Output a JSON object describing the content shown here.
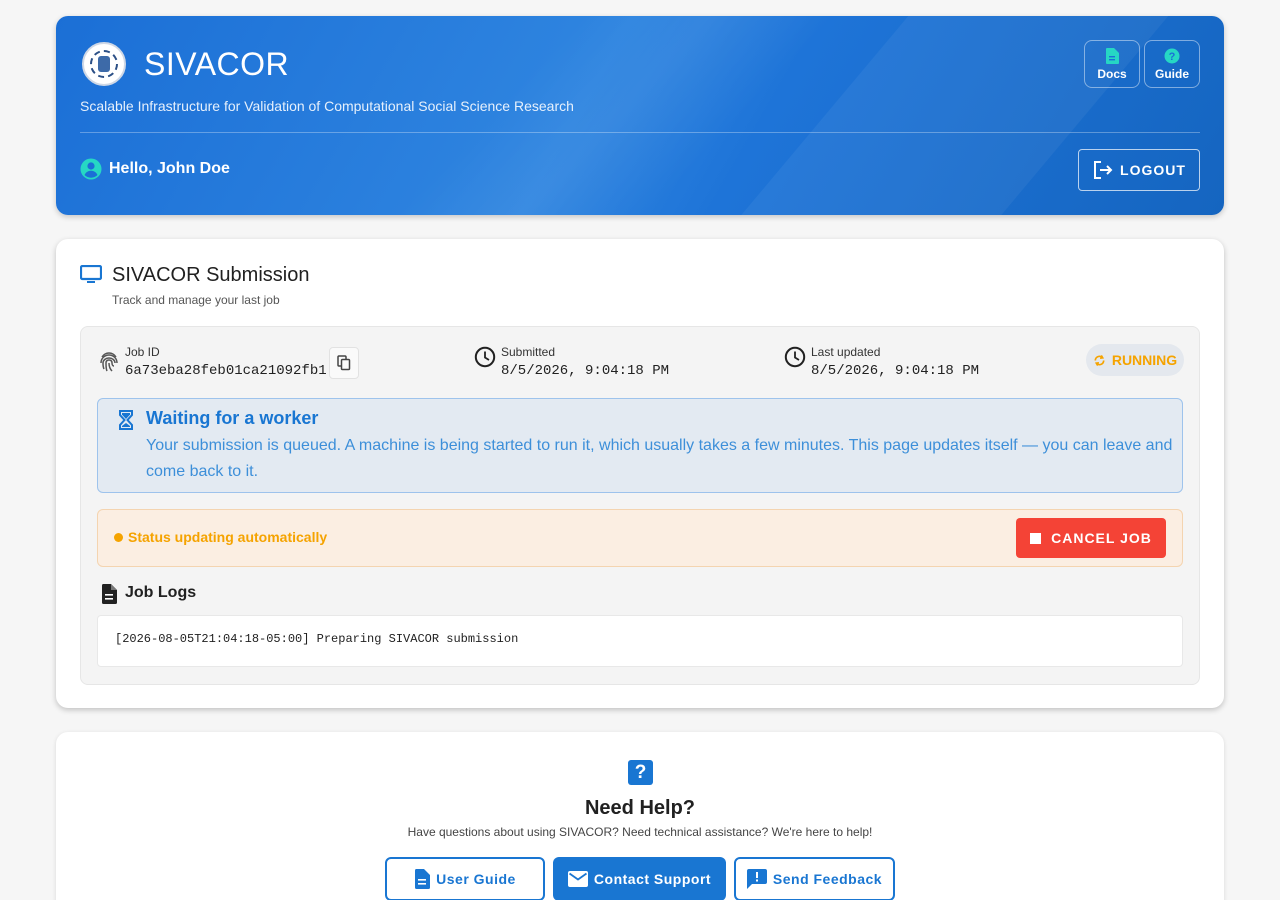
{
  "header": {
    "title": "SIVACOR",
    "subtitle": "Scalable Infrastructure for Validation of Computational Social Science Research",
    "docs_label": "Docs",
    "guide_label": "Guide",
    "greeting": "Hello, John Doe",
    "logout_label": "LOGOUT"
  },
  "submission": {
    "title": "SIVACOR Submission",
    "subtitle": "Track and manage your last job",
    "job_id_label": "Job ID",
    "job_id": "6a73eba28feb01ca21092fb1",
    "submitted_label": "Submitted",
    "submitted": "8/5/2026, 9:04:18 PM",
    "updated_label": "Last updated",
    "updated": "8/5/2026, 9:04:18 PM",
    "status": "RUNNING",
    "info_title": "Waiting for a worker",
    "info_text": "Your submission is queued. A machine is being started to run it, which usually takes a few minutes. This page updates itself — you can leave and come back to it.",
    "auto_status": "Status updating automatically",
    "cancel_label": "CANCEL JOB",
    "logs_title": "Job Logs",
    "log_lines": [
      "[2026-08-05T21:04:18-05:00] Preparing SIVACOR submission"
    ]
  },
  "help": {
    "icon_glyph": "?",
    "title": "Need Help?",
    "subtitle": "Have questions about using SIVACOR? Need technical assistance? We're here to help!",
    "user_guide_label": "User Guide",
    "contact_label": "Contact Support",
    "feedback_label": "Send Feedback"
  },
  "colors": {
    "primary": "#1976d2",
    "accent_teal": "#26d7c4",
    "running": "#f5a300",
    "danger": "#f44336"
  }
}
